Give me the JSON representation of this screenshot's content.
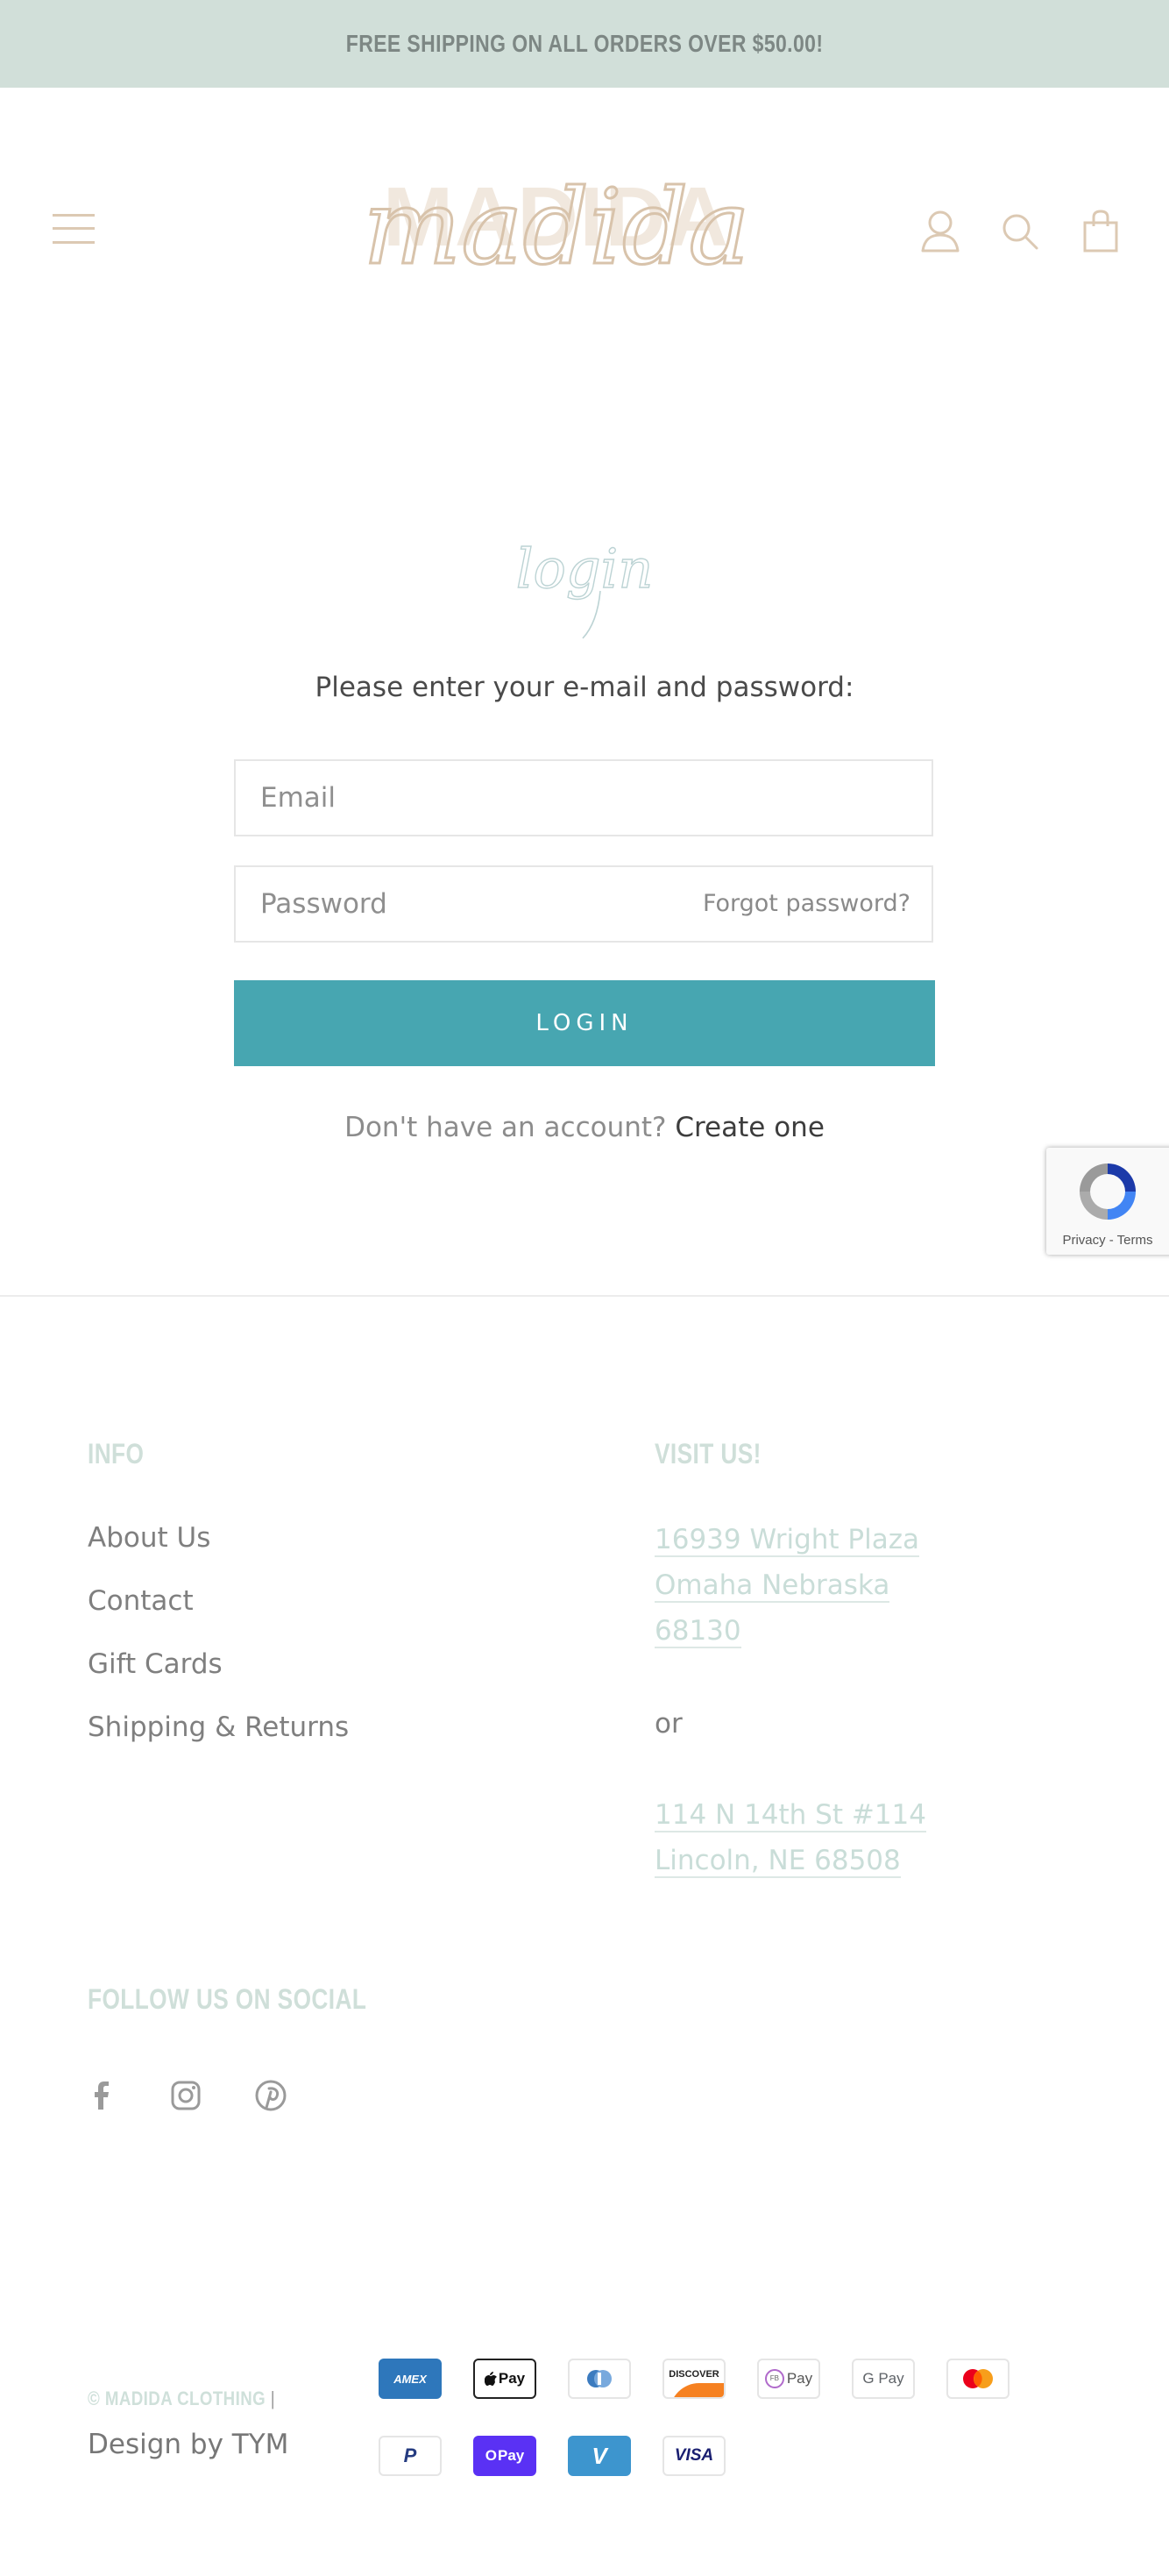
{
  "announcement": {
    "text": "FREE SHIPPING ON ALL ORDERS OVER $50.00!"
  },
  "header": {
    "logo_text": "madida",
    "logo_back_text": "MADIDA",
    "icons": [
      "menu-icon",
      "account-icon",
      "search-icon",
      "cart-icon"
    ]
  },
  "login": {
    "title": "login",
    "intro": "Please enter your e-mail and password:",
    "email_placeholder": "Email",
    "password_placeholder": "Password",
    "forgot_label": "Forgot password?",
    "button_label": "LOGIN",
    "no_account_text": "Don't have an account?",
    "create_link": "Create one"
  },
  "recaptcha": {
    "links": "Privacy - Terms"
  },
  "footer": {
    "info_title": "INFO",
    "info_links": [
      "About Us",
      "Contact",
      "Gift Cards",
      "Shipping & Returns"
    ],
    "visit_title": "VISIT US!",
    "address1": [
      "16939 Wright Plaza",
      "Omaha Nebraska",
      "68130"
    ],
    "or_text": "or",
    "address2": [
      "114 N 14th St #114",
      "Lincoln, NE 68508"
    ],
    "social_title": "FOLLOW US ON SOCIAL",
    "social_icons": [
      "facebook-icon",
      "instagram-icon",
      "pinterest-icon"
    ],
    "copyright": "© MADIDA CLOTHING",
    "separator": "|",
    "design_credit": "Design by TYM",
    "payment_methods": {
      "amex": "AMEX",
      "apple_pay": "Pay",
      "discover": "DISCOVER",
      "fb_pay": "Pay",
      "fb_pay_badge": "FB",
      "google_pay": "G Pay",
      "shop_pay": "Pay",
      "shop_pay_badge": "O",
      "paypal": "P",
      "venmo": "V",
      "visa": "VISA"
    }
  },
  "colors": {
    "announcement_bg": "#d1dfd9",
    "accent_teal": "#47a6b1",
    "logo_beige": "#dcc9b3",
    "footer_title": "#cfdfd9"
  }
}
